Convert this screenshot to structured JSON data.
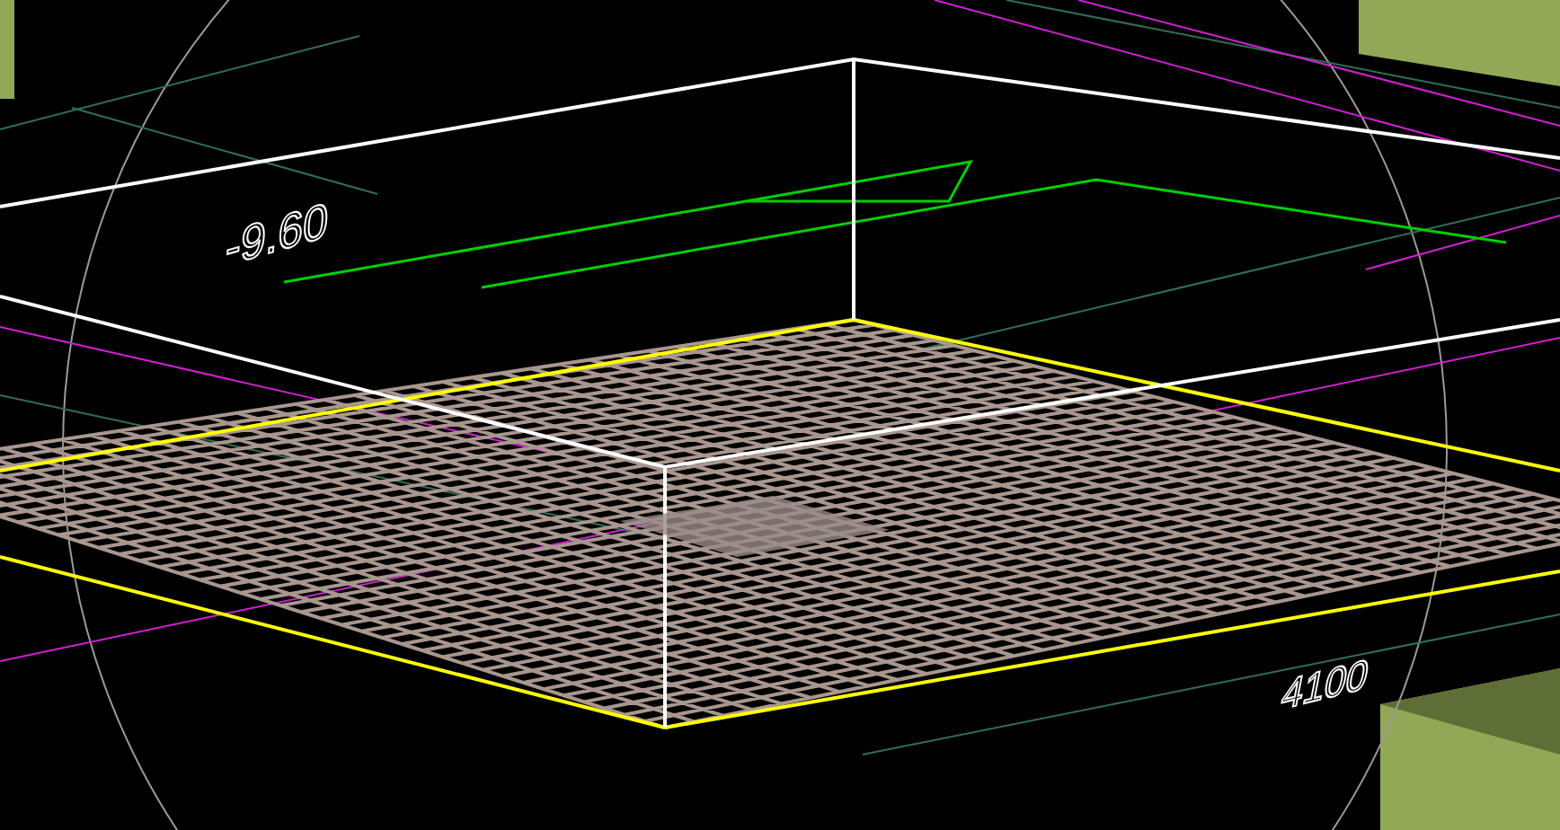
{
  "viewport": {
    "labels": [
      {
        "text": "-9.60",
        "kind": "elevation"
      },
      {
        "text": "4100",
        "kind": "dimension"
      }
    ]
  }
}
